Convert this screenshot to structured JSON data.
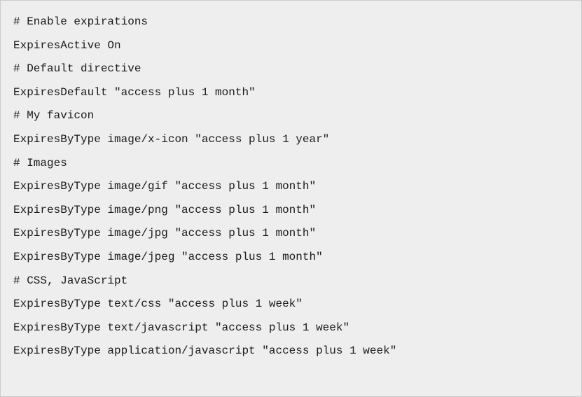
{
  "code": {
    "lines": [
      "# Enable expirations",
      "ExpiresActive On",
      "# Default directive",
      "ExpiresDefault \"access plus 1 month\"",
      "# My favicon",
      "ExpiresByType image/x-icon \"access plus 1 year\"",
      "# Images",
      "ExpiresByType image/gif \"access plus 1 month\"",
      "ExpiresByType image/png \"access plus 1 month\"",
      "ExpiresByType image/jpg \"access plus 1 month\"",
      "ExpiresByType image/jpeg \"access plus 1 month\"",
      "# CSS, JavaScript",
      "ExpiresByType text/css \"access plus 1 week\"",
      "ExpiresByType text/javascript \"access plus 1 week\"",
      "ExpiresByType application/javascript \"access plus 1 week\""
    ]
  }
}
